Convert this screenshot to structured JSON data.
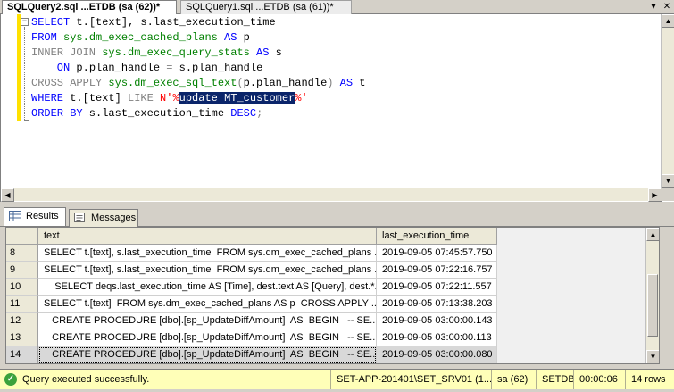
{
  "tabs": [
    {
      "label": "SQLQuery2.sql ...ETDB (sa (62))*"
    },
    {
      "label": "SQLQuery1.sql ...ETDB (sa (61))*"
    }
  ],
  "tab_tools": {
    "dropdown": "▾",
    "close": "✕"
  },
  "editor": {
    "l1": {
      "kw1": "SELECT",
      "rest": " t.[text], s.last_execution_time"
    },
    "l2": {
      "kw1": "FROM",
      "obj": " sys.dm_exec_cached_plans",
      "kw2": " AS",
      "rest": " p"
    },
    "l3": {
      "kw1": "INNER JOIN",
      "obj": " sys.dm_exec_query_stats",
      "kw2": " AS",
      "rest": " s"
    },
    "l4": {
      "kw1": "    ON",
      "rest": " p.plan_handle ",
      "op": "=",
      "rest2": " s.plan_handle"
    },
    "l5": {
      "kw1": "CROSS APPLY",
      "obj": " sys.dm_exec_sql_text",
      "p1": "(",
      "rest": "p.plan_handle",
      "p2": ")",
      "kw2": " AS",
      "rest2": " t"
    },
    "l6": {
      "kw1": "WHERE",
      "rest": " t.[text] ",
      "op": "LIKE",
      "str1": " N'%",
      "sel": "update MT_customer",
      "str2": "%'"
    },
    "l7": {
      "kw1": "ORDER BY",
      "rest": " s.last_execution_time ",
      "kw2": "DESC",
      "end": ";"
    },
    "collapse": "−"
  },
  "results_tabs": {
    "results": "Results",
    "messages": "Messages"
  },
  "grid": {
    "headers": {
      "text": "text",
      "time": "last_execution_time"
    },
    "rows": [
      {
        "n": "8",
        "text": "SELECT t.[text], s.last_execution_time  FROM sys.dm_exec_cached_plans ...",
        "time": "2019-09-05 07:45:57.750"
      },
      {
        "n": "9",
        "text": "SELECT t.[text], s.last_execution_time  FROM sys.dm_exec_cached_plans ...",
        "time": "2019-09-05 07:22:16.757"
      },
      {
        "n": "10",
        "text": "    SELECT deqs.last_execution_time AS [Time], dest.text AS [Query], dest.*...",
        "time": "2019-09-05 07:22:11.557"
      },
      {
        "n": "11",
        "text": "SELECT t.[text]  FROM sys.dm_exec_cached_plans AS p  CROSS APPLY ...",
        "time": "2019-09-05 07:13:38.203"
      },
      {
        "n": "12",
        "text": "   CREATE PROCEDURE [dbo].[sp_UpdateDiffAmount]  AS  BEGIN   -- SE...",
        "time": "2019-09-05 03:00:00.143"
      },
      {
        "n": "13",
        "text": "   CREATE PROCEDURE [dbo].[sp_UpdateDiffAmount]  AS  BEGIN   -- SE...",
        "time": "2019-09-05 03:00:00.113"
      },
      {
        "n": "14",
        "text": "   CREATE PROCEDURE [dbo].[sp_UpdateDiffAmount]  AS  BEGIN   -- SE...",
        "time": "2019-09-05 03:00:00.080"
      }
    ]
  },
  "status": {
    "message": "Query executed successfully.",
    "server": "SET-APP-201401\\SET_SRV01 (1...",
    "user": "sa (62)",
    "db": "SETDB",
    "elapsed": "00:00:06",
    "rows": "14 rows"
  },
  "colors": {
    "keyword": "#0000ff",
    "function": "#ff00ff",
    "system_object": "#008000",
    "string": "#ff0000",
    "selection": "#0a246a",
    "status_bar": "#ffffb8"
  },
  "icons": {
    "results": "grid-icon",
    "messages": "messages-icon",
    "status": "check-circle-icon"
  }
}
